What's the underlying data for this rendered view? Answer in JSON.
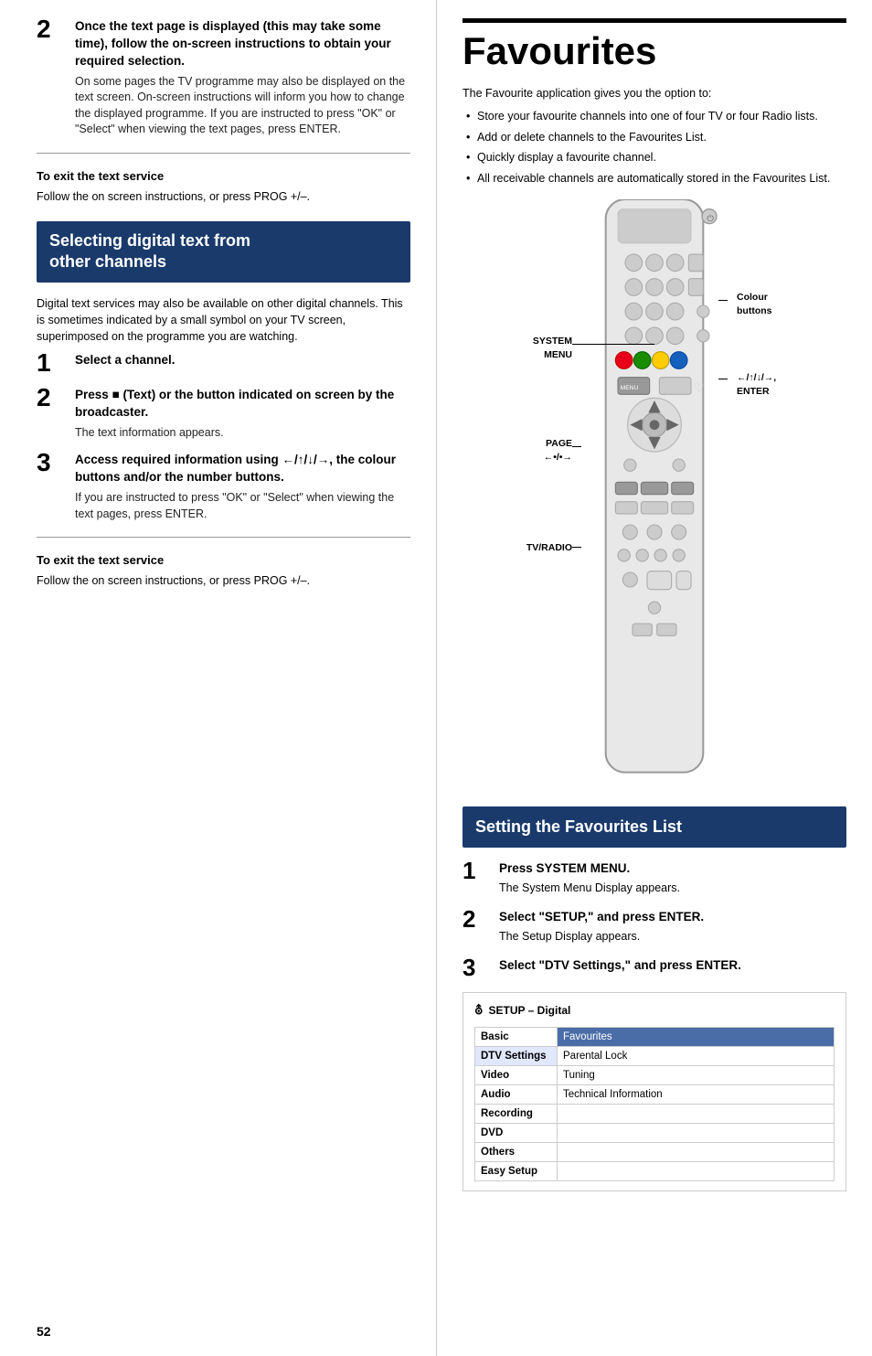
{
  "page": {
    "number": "52",
    "left": {
      "step2": {
        "num": "2",
        "bold": "Once the text page is displayed (this may take some time), follow the on-screen instructions to obtain your required selection.",
        "normal": "On some pages the TV programme may also be displayed on the text screen. On-screen instructions will inform you how to change the displayed programme. If you are instructed to press \"OK\" or \"Select\" when viewing the text pages, press ENTER."
      },
      "exit1_heading": "To exit the text service",
      "exit1_text": "Follow the on screen instructions, or press PROG +/–.",
      "section_title_line1": "Selecting digital text from",
      "section_title_line2": "other channels",
      "section_para": "Digital text services may also be available on other digital channels. This is sometimes indicated by a small symbol on your TV screen, superimposed on the programme you are watching.",
      "step1_select": {
        "num": "1",
        "bold": "Select a channel."
      },
      "step2_press": {
        "num": "2",
        "bold": "Press  (Text) or the button indicated on screen by the broadcaster.",
        "normal": "The text information appears."
      },
      "step3_access": {
        "num": "3",
        "bold": "Access required information using ←/↑/↓/→, the colour buttons and/or the number buttons.",
        "normal": "If you are instructed to press \"OK\" or \"Select\" when viewing the text pages, press ENTER."
      },
      "exit2_heading": "To exit the text service",
      "exit2_text": "Follow the on screen instructions, or press PROG +/–."
    },
    "right": {
      "fav_title": "Favourites",
      "fav_intro": "The Favourite application gives you the option to:",
      "fav_bullets": [
        "Store your favourite channels into one of four TV or four Radio lists.",
        "Add or delete channels to the Favourites List.",
        "Quickly display a favourite channel.",
        "All receivable channels are automatically stored in the Favourites List."
      ],
      "remote_labels": {
        "system_menu": "SYSTEM\nMENU",
        "page": "PAGE\n←•/•→",
        "tv_radio": "TV/RADIO",
        "colour_buttons": "Colour\nbuttons",
        "enter": "←/↑/↓/→,\nENTER"
      },
      "fav_list_section_title": "Setting the Favourites List",
      "step1_press": {
        "num": "1",
        "bold": "Press SYSTEM MENU.",
        "normal": "The System Menu Display appears."
      },
      "step2_select": {
        "num": "2",
        "bold": "Select \"SETUP,\" and press ENTER.",
        "normal": "The Setup Display appears."
      },
      "step3_dtv": {
        "num": "3",
        "bold": "Select \"DTV Settings,\" and press ENTER."
      },
      "setup_header": "SETUP – Digital",
      "setup_table": {
        "left_col": [
          "Basic",
          "DTV Settings",
          "Video",
          "Audio",
          "Recording",
          "DVD",
          "Others",
          "Easy Setup"
        ],
        "right_col": [
          "Favourites",
          "Parental Lock",
          "Tuning",
          "Technical Information",
          "",
          "",
          "",
          ""
        ]
      }
    }
  }
}
